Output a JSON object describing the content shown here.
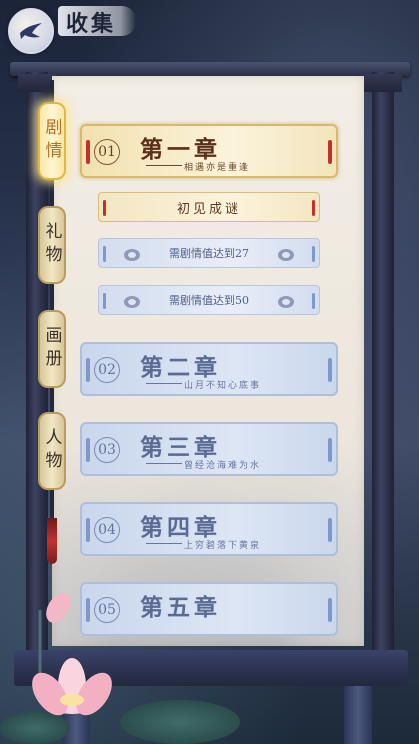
{
  "header": {
    "title": "收集",
    "back_icon": "swallow-icon"
  },
  "tabs": [
    {
      "label": "剧情",
      "active": true
    },
    {
      "label": "礼物",
      "active": false
    },
    {
      "label": "画册",
      "active": false
    },
    {
      "label": "人物",
      "active": false
    }
  ],
  "chapters": [
    {
      "num": "01",
      "title": "第一章",
      "subtitle": "相遇亦是重逢",
      "state": "unlocked"
    },
    {
      "num": "02",
      "title": "第二章",
      "subtitle": "山月不知心底事",
      "state": "locked"
    },
    {
      "num": "03",
      "title": "第三章",
      "subtitle": "曾经沧海难为水",
      "state": "locked"
    },
    {
      "num": "04",
      "title": "第四章",
      "subtitle": "上穷碧落下黄泉",
      "state": "locked"
    },
    {
      "num": "05",
      "title": "第五章",
      "subtitle": "",
      "state": "locked"
    }
  ],
  "sub_items": [
    {
      "label": "初见成谜",
      "state": "unlocked"
    },
    {
      "label": "需剧情值达到27",
      "state": "locked"
    },
    {
      "label": "需剧情值达到50",
      "state": "locked"
    }
  ],
  "colors": {
    "active_gold": "#e0b84a",
    "locked_blue": "#aebfdc",
    "accent_red": "#c0322e"
  }
}
